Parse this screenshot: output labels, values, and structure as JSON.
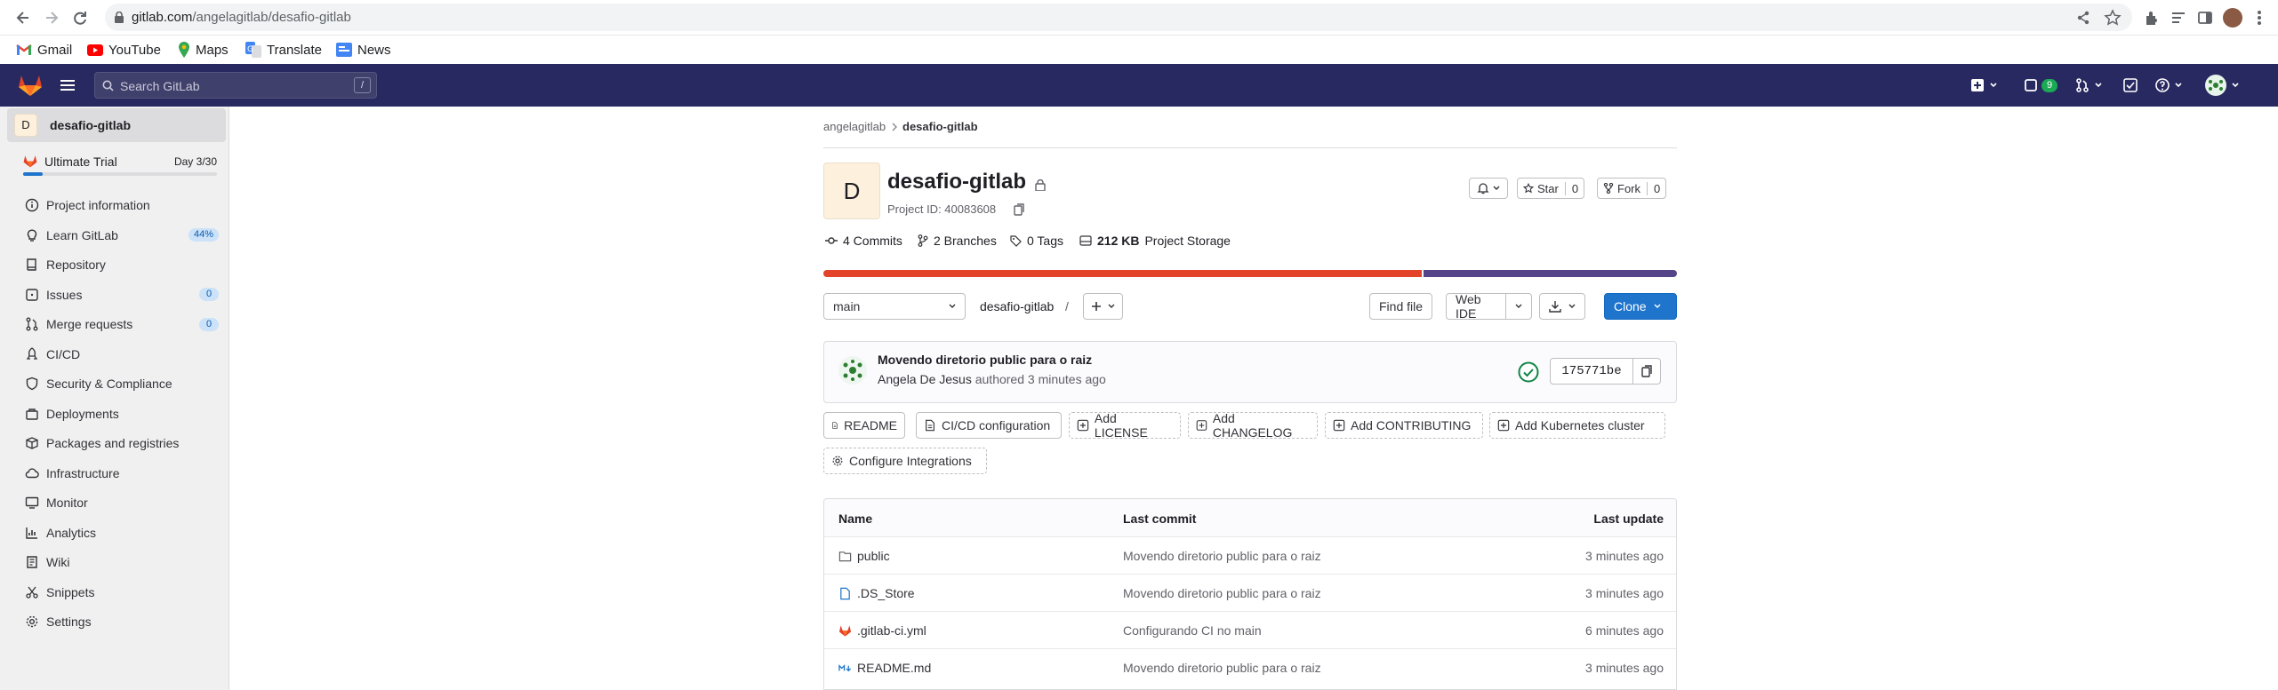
{
  "browser": {
    "url_host": "gitlab.com",
    "url_path": "/angelagitlab/desafio-gitlab",
    "bookmarks": [
      "Gmail",
      "YouTube",
      "Maps",
      "Translate",
      "News"
    ]
  },
  "header": {
    "search_placeholder": "Search GitLab",
    "search_shortcut": "/",
    "issues_count": "9"
  },
  "sidebar": {
    "project_initial": "D",
    "project_name": "desafio-gitlab",
    "trial_label": "Ultimate Trial",
    "trial_day": "Day 3/30",
    "trial_progress": 0.1,
    "items": [
      {
        "label": "Project information",
        "icon": "info-icon"
      },
      {
        "label": "Learn GitLab",
        "icon": "bulb-icon",
        "badge": "44%"
      },
      {
        "label": "Repository",
        "icon": "book-icon"
      },
      {
        "label": "Issues",
        "icon": "issues-icon",
        "badge": "0"
      },
      {
        "label": "Merge requests",
        "icon": "merge-icon",
        "badge": "0"
      },
      {
        "label": "CI/CD",
        "icon": "rocket-icon"
      },
      {
        "label": "Security & Compliance",
        "icon": "shield-icon"
      },
      {
        "label": "Deployments",
        "icon": "deploy-icon"
      },
      {
        "label": "Packages and registries",
        "icon": "package-icon"
      },
      {
        "label": "Infrastructure",
        "icon": "cloud-icon"
      },
      {
        "label": "Monitor",
        "icon": "monitor-icon"
      },
      {
        "label": "Analytics",
        "icon": "chart-icon"
      },
      {
        "label": "Wiki",
        "icon": "wiki-icon"
      },
      {
        "label": "Snippets",
        "icon": "scissors-icon"
      },
      {
        "label": "Settings",
        "icon": "gear-icon"
      }
    ]
  },
  "main": {
    "breadcrumb": [
      "angelagitlab",
      "desafio-gitlab"
    ],
    "project_initial": "D",
    "project_title": "desafio-gitlab",
    "project_id": "Project ID: 40083608",
    "star_label": "Star",
    "star_count": "0",
    "fork_label": "Fork",
    "fork_count": "0",
    "stats": {
      "commits": "4 Commits",
      "branches": "2 Branches",
      "tags": "0 Tags",
      "storage_size": "212 KB",
      "storage_label": "Project Storage"
    },
    "language_bar": [
      {
        "share": 0.703,
        "color": "#e24329"
      },
      {
        "share": 0.297,
        "color": "#554488"
      }
    ],
    "branch": "main",
    "repo_path": "desafio-gitlab",
    "path_sep": "/",
    "find_file": "Find file",
    "web_ide": "Web IDE",
    "clone": "Clone",
    "commit": {
      "title": "Movendo diretorio public para o raiz",
      "author": "Angela De Jesus",
      "meta": "authored 3 minutes ago",
      "sha": "175771be"
    },
    "shortcuts": [
      {
        "label": "README",
        "dashed": false,
        "icon": "doc-icon"
      },
      {
        "label": "CI/CD configuration",
        "dashed": false,
        "icon": "doc-icon"
      },
      {
        "label": "Add LICENSE",
        "dashed": true,
        "icon": "plus-square-icon"
      },
      {
        "label": "Add CHANGELOG",
        "dashed": true,
        "icon": "plus-square-icon"
      },
      {
        "label": "Add CONTRIBUTING",
        "dashed": true,
        "icon": "plus-square-icon"
      },
      {
        "label": "Add Kubernetes cluster",
        "dashed": true,
        "icon": "plus-square-icon"
      },
      {
        "label": "Configure Integrations",
        "dashed": true,
        "icon": "gear-icon"
      }
    ],
    "table": {
      "headers": [
        "Name",
        "Last commit",
        "Last update"
      ],
      "rows": [
        {
          "name": "public",
          "icon": "folder-icon",
          "commit": "Movendo diretorio public para o raiz",
          "updated": "3 minutes ago"
        },
        {
          "name": ".DS_Store",
          "icon": "file-icon",
          "commit": "Movendo diretorio public para o raiz",
          "updated": "3 minutes ago"
        },
        {
          "name": ".gitlab-ci.yml",
          "icon": "gitlab-file-icon",
          "commit": "Configurando CI no main",
          "updated": "6 minutes ago"
        },
        {
          "name": "README.md",
          "icon": "markdown-icon",
          "commit": "Movendo diretorio public para o raiz",
          "updated": "3 minutes ago"
        }
      ]
    }
  }
}
